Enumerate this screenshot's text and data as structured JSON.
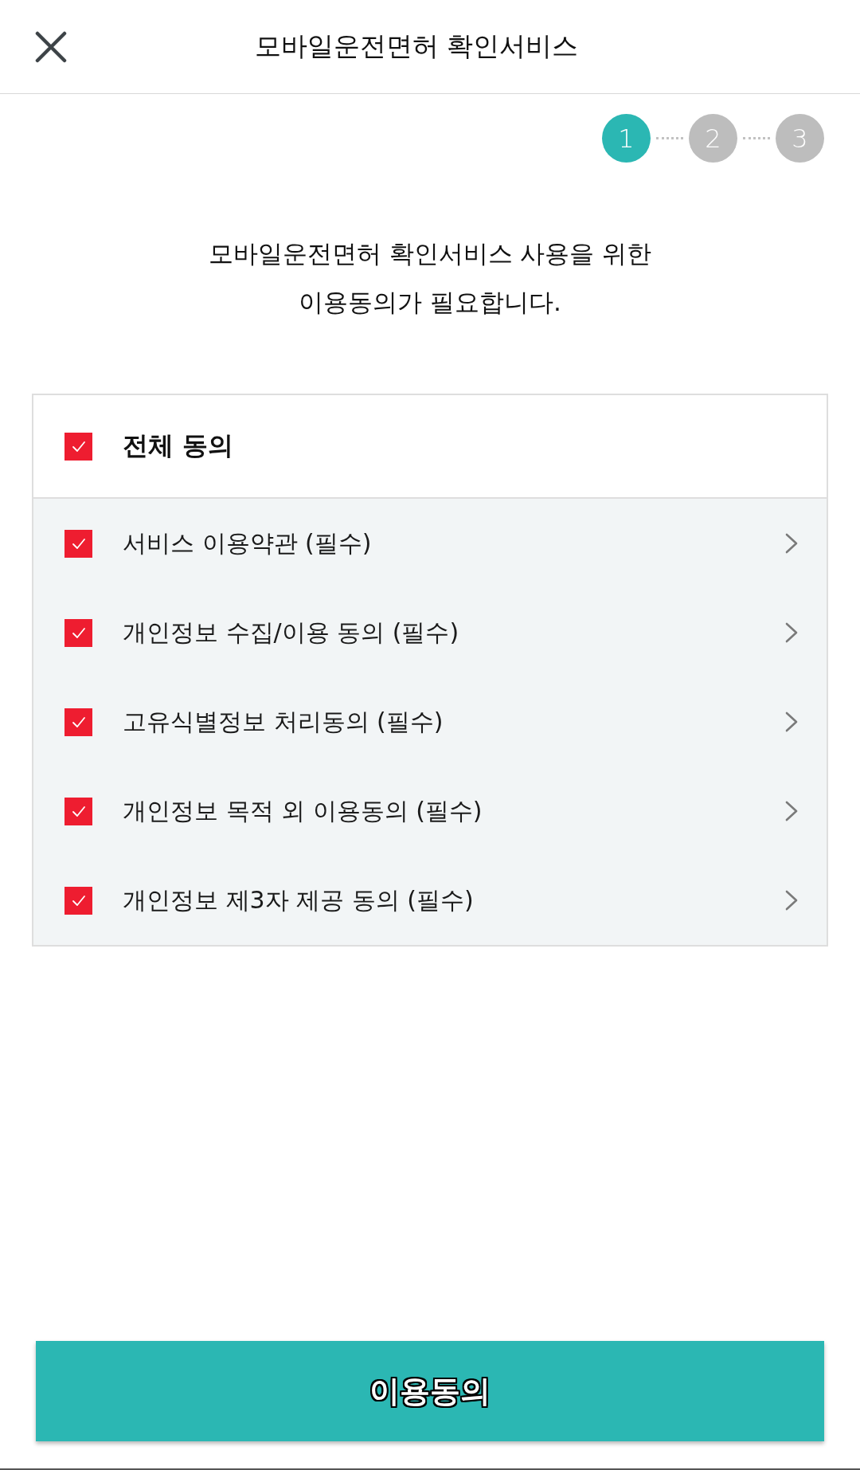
{
  "header": {
    "title": "모바일운전면허 확인서비스"
  },
  "stepper": {
    "steps": [
      {
        "label": "1",
        "selected": true
      },
      {
        "label": "2",
        "selected": false
      },
      {
        "label": "3",
        "selected": false
      }
    ]
  },
  "message": "모바일운전면허 확인서비스 사용을 위한\n이용동의가 필요합니다.",
  "agreement": {
    "all": {
      "label": "전체 동의",
      "checked": true
    },
    "items": [
      {
        "label": "서비스 이용약관 (필수)",
        "checked": true
      },
      {
        "label": "개인정보 수집/이용 동의 (필수)",
        "checked": true
      },
      {
        "label": "고유식별정보 처리동의 (필수)",
        "checked": true
      },
      {
        "label": "개인정보 목적 외 이용동의 (필수)",
        "checked": true
      },
      {
        "label": "개인정보 제3자 제공 동의 (필수)",
        "checked": true
      }
    ]
  },
  "submit_button": {
    "label": "이용동의"
  }
}
